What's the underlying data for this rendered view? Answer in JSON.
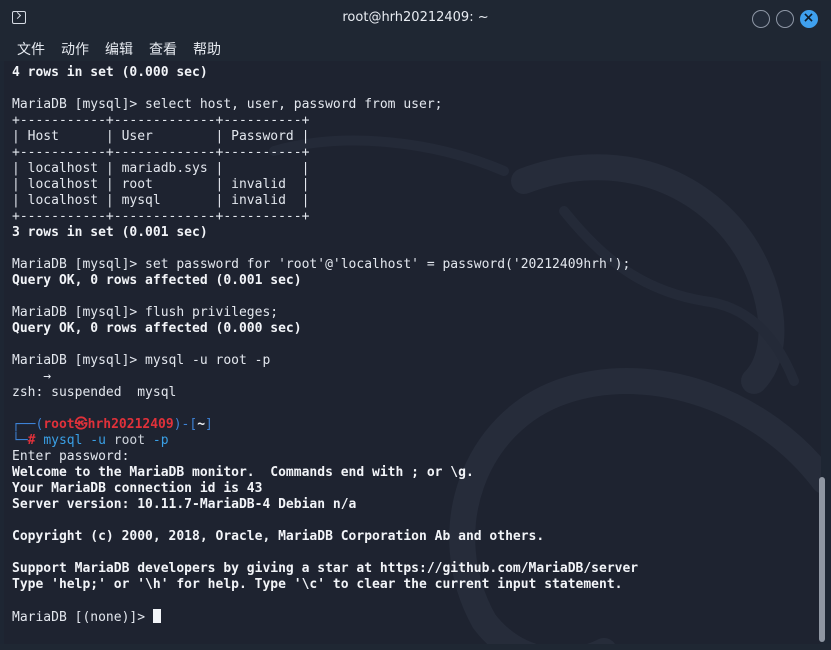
{
  "window": {
    "title": "root@hrh20212409: ~"
  },
  "menu": [
    "文件",
    "动作",
    "编辑",
    "查看",
    "帮助"
  ],
  "terminal": {
    "l01": "4 rows in set (0.000 sec)",
    "l03": "MariaDB [mysql]> select host, user, password from user;",
    "l04": "+-----------+-------------+----------+",
    "l05": "| Host      | User        | Password |",
    "l06": "+-----------+-------------+----------+",
    "l07": "| localhost | mariadb.sys |          |",
    "l08": "| localhost | root        | invalid  |",
    "l09": "| localhost | mysql       | invalid  |",
    "l10": "+-----------+-------------+----------+",
    "l11": "3 rows in set (0.001 sec)",
    "l13": "MariaDB [mysql]> set password for 'root'@'localhost' = password('20212409hrh');",
    "l14": "Query OK, 0 rows affected (0.001 sec)",
    "l16": "MariaDB [mysql]> flush privileges;",
    "l17": "Query OK, 0 rows affected (0.000 sec)",
    "l19": "MariaDB [mysql]> mysql -u root -p",
    "l20": "    →",
    "l21": "zsh: suspended  mysql",
    "prompt": {
      "open": "┌──(",
      "user_host": "root㉿hrh20212409",
      "mid": ")-[",
      "dir": "~",
      "close": "]",
      "second_prefix": "└─",
      "hash": "#",
      "cmd": "mysql",
      "args_pre": " -u ",
      "arg_user": "root",
      "args_post": " -p"
    },
    "l24": "Enter password:",
    "l25": "Welcome to the MariaDB monitor.  Commands end with ; or \\g.",
    "l26": "Your MariaDB connection id is 43",
    "l27": "Server version: 10.11.7-MariaDB-4 Debian n/a",
    "l29": "Copyright (c) 2000, 2018, Oracle, MariaDB Corporation Ab and others.",
    "l31": "Support MariaDB developers by giving a star at https://github.com/MariaDB/server",
    "l32": "Type 'help;' or '\\h' for help. Type '\\c' to clear the current input statement.",
    "l34": "MariaDB [(none)]> "
  }
}
